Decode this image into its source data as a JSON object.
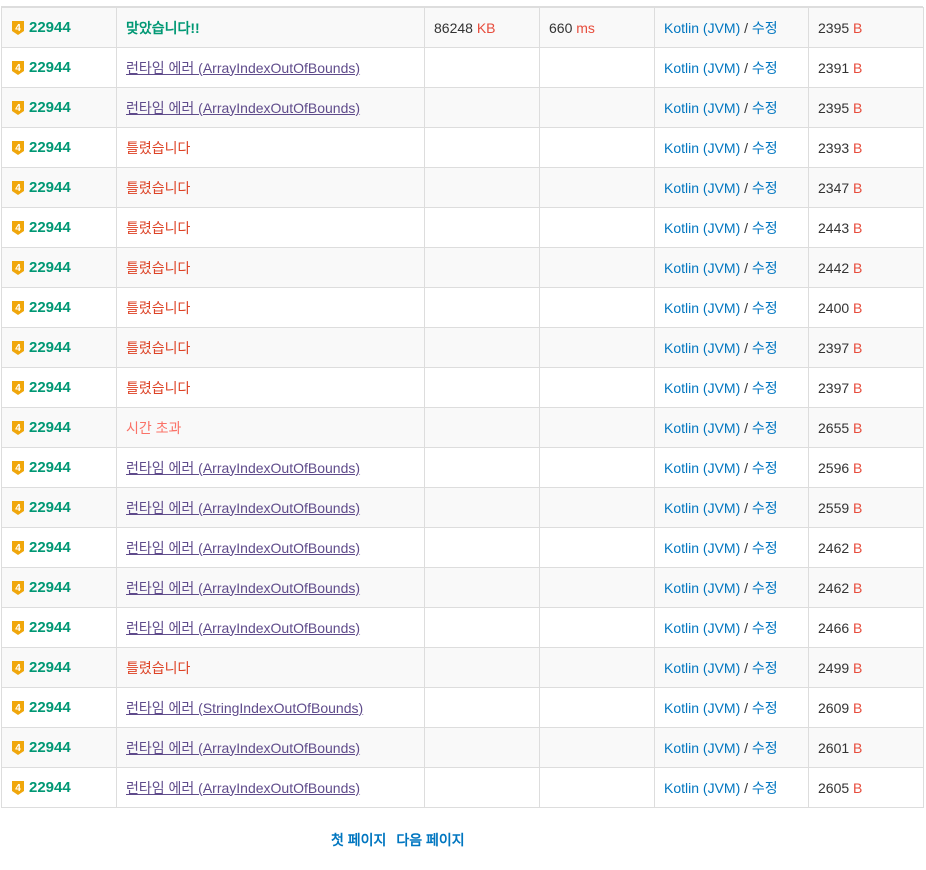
{
  "status_table": {
    "tier_badge_text": "4",
    "tier_color": "#f0a70c",
    "rows": [
      {
        "problem": "22944",
        "result": "맞았습니다!!",
        "result_type": "ac",
        "memory": "86248",
        "memory_unit": "KB",
        "time": "660",
        "time_unit": "ms",
        "language": "Kotlin (JVM)",
        "separator": "/",
        "edit": "수정",
        "code_length": "2395",
        "length_unit": "B"
      },
      {
        "problem": "22944",
        "result": "런타임 에러 (ArrayIndexOutOfBounds)",
        "result_type": "rte",
        "memory": "",
        "memory_unit": "",
        "time": "",
        "time_unit": "",
        "language": "Kotlin (JVM)",
        "separator": "/",
        "edit": "수정",
        "code_length": "2391",
        "length_unit": "B"
      },
      {
        "problem": "22944",
        "result": "런타임 에러 (ArrayIndexOutOfBounds)",
        "result_type": "rte",
        "memory": "",
        "memory_unit": "",
        "time": "",
        "time_unit": "",
        "language": "Kotlin (JVM)",
        "separator": "/",
        "edit": "수정",
        "code_length": "2395",
        "length_unit": "B"
      },
      {
        "problem": "22944",
        "result": "틀렸습니다",
        "result_type": "wa",
        "memory": "",
        "memory_unit": "",
        "time": "",
        "time_unit": "",
        "language": "Kotlin (JVM)",
        "separator": "/",
        "edit": "수정",
        "code_length": "2393",
        "length_unit": "B"
      },
      {
        "problem": "22944",
        "result": "틀렸습니다",
        "result_type": "wa",
        "memory": "",
        "memory_unit": "",
        "time": "",
        "time_unit": "",
        "language": "Kotlin (JVM)",
        "separator": "/",
        "edit": "수정",
        "code_length": "2347",
        "length_unit": "B"
      },
      {
        "problem": "22944",
        "result": "틀렸습니다",
        "result_type": "wa",
        "memory": "",
        "memory_unit": "",
        "time": "",
        "time_unit": "",
        "language": "Kotlin (JVM)",
        "separator": "/",
        "edit": "수정",
        "code_length": "2443",
        "length_unit": "B"
      },
      {
        "problem": "22944",
        "result": "틀렸습니다",
        "result_type": "wa",
        "memory": "",
        "memory_unit": "",
        "time": "",
        "time_unit": "",
        "language": "Kotlin (JVM)",
        "separator": "/",
        "edit": "수정",
        "code_length": "2442",
        "length_unit": "B"
      },
      {
        "problem": "22944",
        "result": "틀렸습니다",
        "result_type": "wa",
        "memory": "",
        "memory_unit": "",
        "time": "",
        "time_unit": "",
        "language": "Kotlin (JVM)",
        "separator": "/",
        "edit": "수정",
        "code_length": "2400",
        "length_unit": "B"
      },
      {
        "problem": "22944",
        "result": "틀렸습니다",
        "result_type": "wa",
        "memory": "",
        "memory_unit": "",
        "time": "",
        "time_unit": "",
        "language": "Kotlin (JVM)",
        "separator": "/",
        "edit": "수정",
        "code_length": "2397",
        "length_unit": "B"
      },
      {
        "problem": "22944",
        "result": "틀렸습니다",
        "result_type": "wa",
        "memory": "",
        "memory_unit": "",
        "time": "",
        "time_unit": "",
        "language": "Kotlin (JVM)",
        "separator": "/",
        "edit": "수정",
        "code_length": "2397",
        "length_unit": "B"
      },
      {
        "problem": "22944",
        "result": "시간 초과",
        "result_type": "tle",
        "memory": "",
        "memory_unit": "",
        "time": "",
        "time_unit": "",
        "language": "Kotlin (JVM)",
        "separator": "/",
        "edit": "수정",
        "code_length": "2655",
        "length_unit": "B"
      },
      {
        "problem": "22944",
        "result": "런타임 에러 (ArrayIndexOutOfBounds)",
        "result_type": "rte",
        "memory": "",
        "memory_unit": "",
        "time": "",
        "time_unit": "",
        "language": "Kotlin (JVM)",
        "separator": "/",
        "edit": "수정",
        "code_length": "2596",
        "length_unit": "B"
      },
      {
        "problem": "22944",
        "result": "런타임 에러 (ArrayIndexOutOfBounds)",
        "result_type": "rte",
        "memory": "",
        "memory_unit": "",
        "time": "",
        "time_unit": "",
        "language": "Kotlin (JVM)",
        "separator": "/",
        "edit": "수정",
        "code_length": "2559",
        "length_unit": "B"
      },
      {
        "problem": "22944",
        "result": "런타임 에러 (ArrayIndexOutOfBounds)",
        "result_type": "rte",
        "memory": "",
        "memory_unit": "",
        "time": "",
        "time_unit": "",
        "language": "Kotlin (JVM)",
        "separator": "/",
        "edit": "수정",
        "code_length": "2462",
        "length_unit": "B"
      },
      {
        "problem": "22944",
        "result": "런타임 에러 (ArrayIndexOutOfBounds)",
        "result_type": "rte",
        "memory": "",
        "memory_unit": "",
        "time": "",
        "time_unit": "",
        "language": "Kotlin (JVM)",
        "separator": "/",
        "edit": "수정",
        "code_length": "2462",
        "length_unit": "B"
      },
      {
        "problem": "22944",
        "result": "런타임 에러 (ArrayIndexOutOfBounds)",
        "result_type": "rte",
        "memory": "",
        "memory_unit": "",
        "time": "",
        "time_unit": "",
        "language": "Kotlin (JVM)",
        "separator": "/",
        "edit": "수정",
        "code_length": "2466",
        "length_unit": "B"
      },
      {
        "problem": "22944",
        "result": "틀렸습니다",
        "result_type": "wa",
        "memory": "",
        "memory_unit": "",
        "time": "",
        "time_unit": "",
        "language": "Kotlin (JVM)",
        "separator": "/",
        "edit": "수정",
        "code_length": "2499",
        "length_unit": "B"
      },
      {
        "problem": "22944",
        "result": "런타임 에러 (StringIndexOutOfBounds)",
        "result_type": "rte",
        "memory": "",
        "memory_unit": "",
        "time": "",
        "time_unit": "",
        "language": "Kotlin (JVM)",
        "separator": "/",
        "edit": "수정",
        "code_length": "2609",
        "length_unit": "B"
      },
      {
        "problem": "22944",
        "result": "런타임 에러 (ArrayIndexOutOfBounds)",
        "result_type": "rte",
        "memory": "",
        "memory_unit": "",
        "time": "",
        "time_unit": "",
        "language": "Kotlin (JVM)",
        "separator": "/",
        "edit": "수정",
        "code_length": "2601",
        "length_unit": "B"
      },
      {
        "problem": "22944",
        "result": "런타임 에러 (ArrayIndexOutOfBounds)",
        "result_type": "rte",
        "memory": "",
        "memory_unit": "",
        "time": "",
        "time_unit": "",
        "language": "Kotlin (JVM)",
        "separator": "/",
        "edit": "수정",
        "code_length": "2605",
        "length_unit": "B"
      }
    ]
  },
  "pagination": {
    "first_page": "첫 페이지",
    "next_page": "다음 페이지"
  },
  "colors": {
    "accepted": "#009874",
    "wrong": "#dd4124",
    "time_limit": "#fa7268",
    "runtime_error": "#5f4b8b",
    "link": "#0076c0",
    "unit": "#e74c3c"
  }
}
